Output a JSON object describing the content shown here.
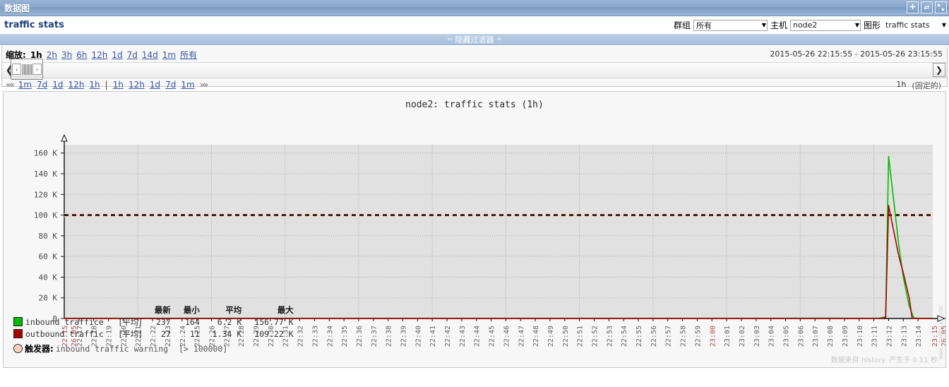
{
  "window": {
    "title": "数据图",
    "buttons": [
      {
        "name": "add-icon",
        "label": "+"
      },
      {
        "name": "refresh-icon",
        "label": "⟳"
      },
      {
        "name": "fullscreen-icon",
        "label": "⛶"
      }
    ]
  },
  "header": {
    "graph_title": "traffic stats",
    "filters": [
      {
        "label": "群组",
        "value": "所有",
        "name": "group"
      },
      {
        "label": "主机",
        "value": "node2",
        "name": "host"
      },
      {
        "label": "图形",
        "value": "traffic stats",
        "name": "graph"
      }
    ]
  },
  "hide_filter": {
    "label": "隐藏过滤器",
    "chevron": "≈"
  },
  "filter_panel": {
    "zoom_label": "缩放:",
    "zoom_options": [
      "1h",
      "2h",
      "3h",
      "6h",
      "12h",
      "1d",
      "7d",
      "14d",
      "1m",
      "所有"
    ],
    "zoom_selected": "1h",
    "date_from": "2015-05-26 22:15:55",
    "date_separator": "-",
    "date_to": "2015-05-26 23:15:55",
    "nav_prev_arrows": "««",
    "nav_next_arrows": "»»",
    "nav_left": [
      "1m",
      "7d",
      "1d",
      "12h",
      "1h"
    ],
    "nav_divider": "|",
    "nav_right": [
      "1h",
      "12h",
      "1d",
      "7d",
      "1m"
    ],
    "period_label": "1h",
    "fixed_label": "(固定的)",
    "slider_left_arrow": "❮",
    "slider_handle_left": "‹",
    "slider_handle_right": "›",
    "slider_right_arrow": "❯"
  },
  "chart_data": {
    "type": "line",
    "title": "node2: traffic stats (1h)",
    "xlabel": "",
    "ylabel": "",
    "ylim": [
      0,
      168000
    ],
    "grid": true,
    "legend_position": "bottom",
    "y_ticks": [
      "0",
      "20 K",
      "40 K",
      "60 K",
      "80 K",
      "100 K",
      "120 K",
      "140 K",
      "160 K"
    ],
    "y_tick_values": [
      0,
      20000,
      40000,
      60000,
      80000,
      100000,
      120000,
      140000,
      160000
    ],
    "x_start_label_top": "26.05",
    "x_start_label_bottom": "22:15",
    "x_end_label_top": "26.05",
    "x_end_label_bottom": "23:15",
    "x_ticks": [
      "22:17",
      "22:18",
      "22:19",
      "22:20",
      "22:21",
      "22:22",
      "22:23",
      "22:24",
      "22:25",
      "22:26",
      "22:27",
      "22:28",
      "22:29",
      "22:30",
      "22:31",
      "22:32",
      "22:33",
      "22:34",
      "22:35",
      "22:36",
      "22:37",
      "22:38",
      "22:39",
      "22:40",
      "22:41",
      "22:42",
      "22:43",
      "22:44",
      "22:45",
      "22:46",
      "22:47",
      "22:48",
      "22:49",
      "22:50",
      "22:51",
      "22:52",
      "22:53",
      "22:54",
      "22:55",
      "22:56",
      "22:57",
      "22:58",
      "22:59",
      "23:00",
      "23:01",
      "23:02",
      "23:03",
      "23:04",
      "23:05",
      "23:06",
      "23:07",
      "23:08",
      "23:09",
      "23:10",
      "23:11",
      "23:12",
      "23:13",
      "23:14",
      "23:15"
    ],
    "x_hour_marks": [
      "23:00"
    ],
    "threshold": {
      "value": 100000,
      "label": "inbound traffic warning",
      "expression": "[> 100000]",
      "color": "#111111"
    },
    "series": [
      {
        "name": "inbound traffice",
        "color": "#00bb00",
        "aggregation": "[平均]",
        "last": "237",
        "min": "164",
        "avg": "6.2 K",
        "max": "156.77 K",
        "points": [
          [
            0,
            200
          ],
          [
            28,
            210
          ],
          [
            40,
            230
          ],
          [
            48,
            220
          ],
          [
            52,
            300
          ],
          [
            53,
            240
          ],
          [
            54,
            250
          ],
          [
            55.0,
            250
          ],
          [
            55.4,
            400
          ],
          [
            55.8,
            1500
          ],
          [
            56.0,
            156770
          ],
          [
            56.3,
            120000
          ],
          [
            56.7,
            70000
          ],
          [
            57.0,
            40000
          ],
          [
            57.4,
            12000
          ],
          [
            57.7,
            600
          ],
          [
            58,
            250
          ],
          [
            59,
            237
          ]
        ]
      },
      {
        "name": "outbound traffic",
        "color": "#aa0000",
        "aggregation": "[平均]",
        "last": "27",
        "min": "11",
        "avg": "1.34 K",
        "max": "109.22 K",
        "points": [
          [
            0,
            20
          ],
          [
            28,
            22
          ],
          [
            40,
            25
          ],
          [
            48,
            24
          ],
          [
            52,
            30
          ],
          [
            53,
            26
          ],
          [
            54,
            28
          ],
          [
            55.0,
            28
          ],
          [
            55.4,
            80
          ],
          [
            55.8,
            900
          ],
          [
            56.0,
            109220
          ],
          [
            56.3,
            88000
          ],
          [
            56.7,
            60000
          ],
          [
            57.0,
            44000
          ],
          [
            57.4,
            20000
          ],
          [
            57.6,
            300
          ],
          [
            58,
            28
          ],
          [
            59,
            27
          ]
        ]
      }
    ],
    "legend_headers": [
      "最新",
      "最小",
      "平均",
      "最大"
    ],
    "trigger_label": "触发器:",
    "trigger_name": "inbound traffic warning",
    "trigger_expr": "[> 100000]"
  },
  "footer": {
    "note": "数据来自 history. 产生于 0.11 秒.",
    "watermark": "www.zabbix.com"
  }
}
